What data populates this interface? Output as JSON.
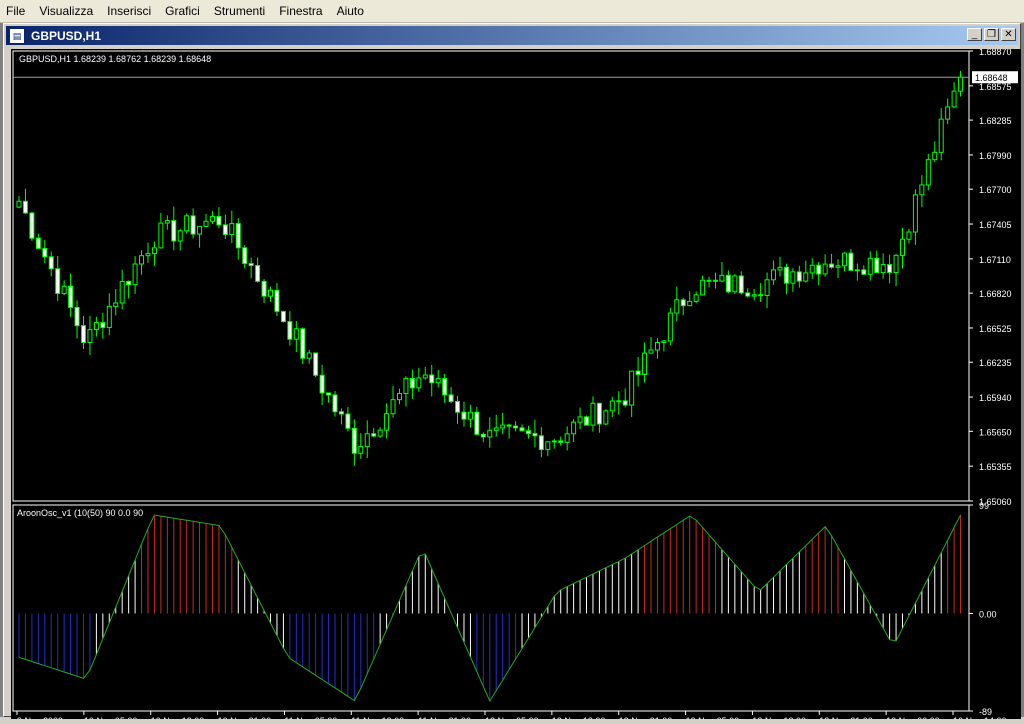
{
  "menu": {
    "items": [
      "File",
      "Visualizza",
      "Inserisci",
      "Grafici",
      "Strumenti",
      "Finestra",
      "Aiuto"
    ]
  },
  "window": {
    "title": "GBPUSD,H1",
    "icon": "chart-window-icon",
    "btn_minimize": "_",
    "btn_restore": "❐",
    "btn_close": "✕"
  },
  "chart": {
    "info_label": "GBPUSD,H1  1.68239 1.68762 1.68239 1.68648",
    "current_price_label": "1.68648",
    "price_ticks": [
      "1.68870",
      "1.68575",
      "1.68285",
      "1.67990",
      "1.67700",
      "1.67405",
      "1.67110",
      "1.66820",
      "1.66525",
      "1.66235",
      "1.65940",
      "1.65650",
      "1.65355",
      "1.65060"
    ],
    "indicator_label": "AroonOsc_v1 (10(50) 90 0.0 90",
    "indicator_ticks": [
      "99",
      "0.00",
      "-89"
    ],
    "time_ticks": [
      "9 Nov 2009",
      "10 Nov 05:00",
      "10 Nov 13:00",
      "10 Nov 21:00",
      "11 Nov 05:00",
      "11 Nov 13:00",
      "11 Nov 21:00",
      "12 Nov 05:00",
      "12 Nov 13:00",
      "12 Nov 21:00",
      "13 Nov 05:00",
      "13 Nov 13:00",
      "13 Nov 21:00",
      "16 Nov 06:00",
      "16 Nov 14:00"
    ],
    "colors": {
      "background": "#000000",
      "candle": "#00ff00",
      "bull_fill": "#000000",
      "bear_fill": "#ffffff",
      "aroon_line": "#22aa22",
      "hist_up": "#cc2a1a",
      "hist_neutral": "#ffffff",
      "hist_down": "#2030d0",
      "axis_text": "#ffffff",
      "price_line": "#9aa0a8"
    }
  },
  "chart_data": [
    {
      "type": "candlestick",
      "title": "GBPUSD,H1",
      "ylim": [
        1.6506,
        1.6887
      ],
      "x": [
        "9 Nov 2009",
        "10 Nov 05:00",
        "10 Nov 13:00",
        "10 Nov 21:00",
        "11 Nov 05:00",
        "11 Nov 13:00",
        "11 Nov 21:00",
        "12 Nov 05:00",
        "12 Nov 13:00",
        "12 Nov 21:00",
        "13 Nov 05:00",
        "13 Nov 13:00",
        "13 Nov 21:00",
        "16 Nov 06:00",
        "16 Nov 14:00"
      ],
      "closes": [
        1.676,
        1.664,
        1.673,
        1.6745,
        1.6655,
        1.6553,
        1.6615,
        1.656,
        1.656,
        1.6595,
        1.6688,
        1.669,
        1.671,
        1.6708,
        1.6865
      ],
      "last": {
        "open": 1.68239,
        "high": 1.68762,
        "low": 1.68239,
        "close": 1.68648
      }
    },
    {
      "type": "bar",
      "title": "AroonOsc_v1 (10(50) 90 0.0 90",
      "ylim": [
        -89,
        99
      ],
      "levels": [
        90,
        0.0,
        90
      ],
      "x": [
        "9 Nov 2009",
        "10 Nov 05:00",
        "10 Nov 13:00",
        "10 Nov 21:00",
        "11 Nov 05:00",
        "11 Nov 13:00",
        "11 Nov 21:00",
        "12 Nov 05:00",
        "12 Nov 13:00",
        "12 Nov 21:00",
        "13 Nov 05:00",
        "13 Nov 13:00",
        "13 Nov 21:00",
        "16 Nov 06:00",
        "16 Nov 14:00"
      ],
      "values": [
        -40,
        -60,
        90,
        80,
        -40,
        -80,
        60,
        -80,
        20,
        50,
        90,
        20,
        80,
        -30,
        90
      ]
    }
  ]
}
